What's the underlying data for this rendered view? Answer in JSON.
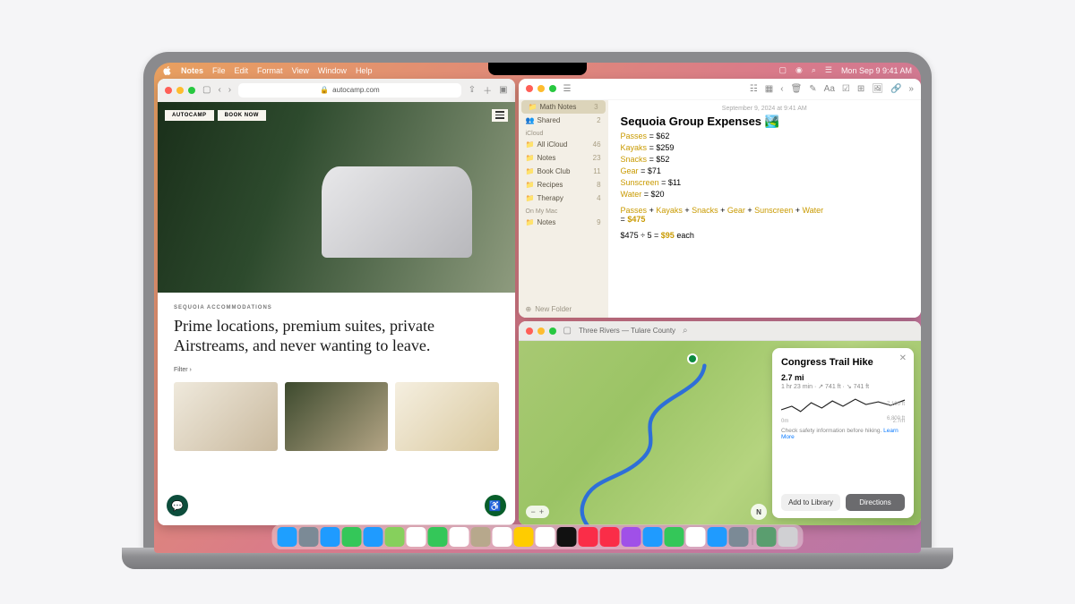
{
  "menubar": {
    "app": "Notes",
    "items": [
      "File",
      "Edit",
      "Format",
      "View",
      "Window",
      "Help"
    ],
    "clock": "Mon Sep 9  9:41 AM"
  },
  "safari": {
    "url": "autocamp.com",
    "brand": "AUTOCAMP",
    "book": "BOOK NOW",
    "crumb": "SEQUOIA ACCOMMODATIONS",
    "headline": "Prime locations, premium suites, private Airstreams, and never wanting to leave.",
    "filter": "Filter ›"
  },
  "notes": {
    "sidebar": {
      "top": [
        {
          "label": "Math Notes",
          "count": "3",
          "selected": true
        },
        {
          "label": "Shared",
          "count": "2"
        }
      ],
      "section_icloud": "iCloud",
      "icloud": [
        {
          "label": "All iCloud",
          "count": "46"
        },
        {
          "label": "Notes",
          "count": "23"
        },
        {
          "label": "Book Club",
          "count": "11"
        },
        {
          "label": "Recipes",
          "count": "8"
        },
        {
          "label": "Therapy",
          "count": "4"
        }
      ],
      "section_mac": "On My Mac",
      "mac": [
        {
          "label": "Notes",
          "count": "9"
        }
      ],
      "new_folder": "New Folder"
    },
    "note": {
      "date": "September 9, 2024 at 9:41 AM",
      "title": "Sequoia Group Expenses 🏞️",
      "items": [
        {
          "k": "Passes",
          "v": "$62"
        },
        {
          "k": "Kayaks",
          "v": "$259"
        },
        {
          "k": "Snacks",
          "v": "$52"
        },
        {
          "k": "Gear",
          "v": "$71"
        },
        {
          "k": "Sunscreen",
          "v": "$11"
        },
        {
          "k": "Water",
          "v": "$20"
        }
      ],
      "calc_vars": [
        "Passes",
        "Kayaks",
        "Snacks",
        "Gear",
        "Sunscreen",
        "Water"
      ],
      "calc_total": "$475",
      "div_expr": "$475 ÷ 5 =",
      "div_result": "$95",
      "div_suffix": "each"
    }
  },
  "maps": {
    "title": "Three Rivers — Tulare County",
    "card": {
      "title": "Congress Trail Hike",
      "distance": "2.7 mi",
      "subtitle": "1 hr 23 min · ↗ 741 ft · ↘ 741 ft",
      "axis_start": "0m",
      "axis_end": "2.7m",
      "elev_hi": "7,100 ft",
      "elev_lo": "6,800 ft",
      "warning": "Check safety information before hiking.",
      "learn": "Learn More",
      "btn_lib": "Add to Library",
      "btn_dir": "Directions"
    },
    "compass": "N"
  },
  "dock": [
    {
      "n": "finder",
      "c": "#1e9fff"
    },
    {
      "n": "launchpad",
      "c": "#7b8a96"
    },
    {
      "n": "safari",
      "c": "#1f9bff"
    },
    {
      "n": "messages",
      "c": "#34c759"
    },
    {
      "n": "mail",
      "c": "#1f9bff"
    },
    {
      "n": "maps",
      "c": "#86d05c"
    },
    {
      "n": "photos",
      "c": "#ffffff"
    },
    {
      "n": "facetime",
      "c": "#34c759"
    },
    {
      "n": "calendar",
      "c": "#ffffff"
    },
    {
      "n": "contacts",
      "c": "#b7a88c"
    },
    {
      "n": "reminders",
      "c": "#ffffff"
    },
    {
      "n": "notes",
      "c": "#ffcc00"
    },
    {
      "n": "freeform",
      "c": "#ffffff"
    },
    {
      "n": "tv",
      "c": "#111"
    },
    {
      "n": "music",
      "c": "#fa2d48"
    },
    {
      "n": "news",
      "c": "#fa2d48"
    },
    {
      "n": "podcasts",
      "c": "#a050e8"
    },
    {
      "n": "appstore",
      "c": "#1f9bff"
    },
    {
      "n": "numbers",
      "c": "#34c759"
    },
    {
      "n": "home",
      "c": "#ffffff"
    },
    {
      "n": "appstore2",
      "c": "#1f9bff"
    },
    {
      "n": "settings",
      "c": "#7b8a96"
    }
  ],
  "dock_right": [
    {
      "n": "downloads",
      "c": "#5a9e6f"
    },
    {
      "n": "trash",
      "c": "#d0d0d3"
    }
  ]
}
